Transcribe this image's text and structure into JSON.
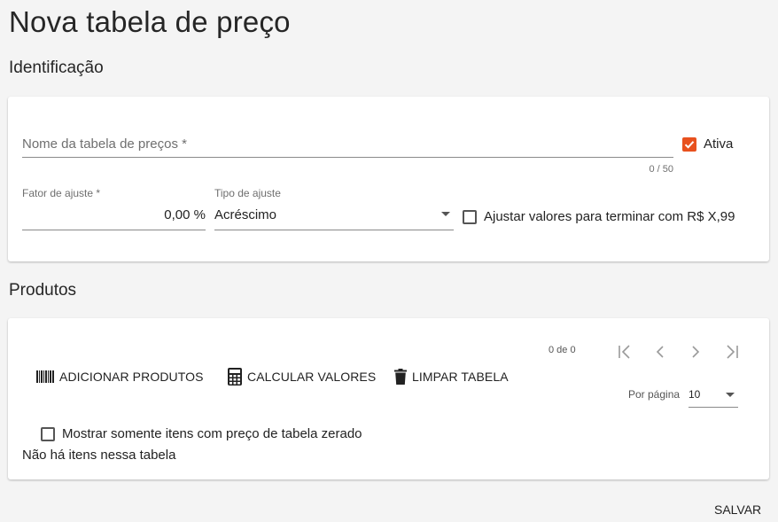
{
  "page": {
    "title": "Nova tabela de preço"
  },
  "identification": {
    "section_title": "Identificação",
    "name_field": {
      "placeholder": "Nome da tabela de preços *",
      "value": "",
      "counter": "0 / 50"
    },
    "active": {
      "label": "Ativa",
      "checked": true
    },
    "adjust_factor": {
      "label": "Fator de ajuste *",
      "value": "0,00 %"
    },
    "adjust_type": {
      "label": "Tipo de ajuste",
      "value": "Acréscimo"
    },
    "round_values": {
      "label": "Ajustar valores para terminar com R$ X,99",
      "checked": false
    }
  },
  "products": {
    "section_title": "Produtos",
    "pager": {
      "range_text": "0 de 0",
      "per_page_label": "Por página",
      "per_page_value": "10"
    },
    "actions": {
      "add_label": "ADICIONAR PRODUTOS",
      "calculate_label": "CALCULAR VALORES",
      "clear_label": "LIMPAR TABELA"
    },
    "zero_price_filter": {
      "label": "Mostrar somente itens com preço de tabela zerado",
      "checked": false
    },
    "empty_message": "Não há itens nessa tabela"
  },
  "footer": {
    "save_label": "SALVAR"
  },
  "colors": {
    "accent": "#e8511e",
    "background": "#f4f4f4",
    "card": "#ffffff"
  }
}
